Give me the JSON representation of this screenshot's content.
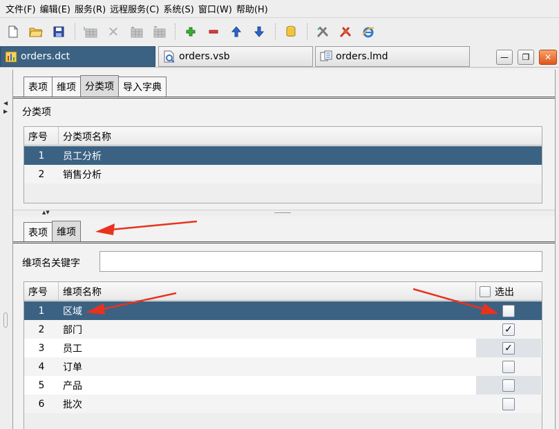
{
  "menu": [
    "文件(F)",
    "编辑(E)",
    "服务(R)",
    "远程服务(C)",
    "系统(S)",
    "窗口(W)",
    "帮助(H)"
  ],
  "toolbar": {
    "icons": [
      "new-file-icon",
      "open-folder-icon",
      "save-icon",
      "table-icon",
      "delete-icon",
      "table-up-icon",
      "table-down-icon",
      "add-icon",
      "remove-icon",
      "move-up-icon",
      "move-down-icon",
      "database-icon",
      "tools-icon",
      "bug-icon",
      "ie-icon"
    ]
  },
  "doc_tabs": [
    {
      "label": "orders.dct",
      "active": true
    },
    {
      "label": "orders.vsb",
      "active": false
    },
    {
      "label": "orders.lmd",
      "active": false
    }
  ],
  "top_tabs": [
    {
      "label": "表项",
      "active": false
    },
    {
      "label": "维项",
      "active": false
    },
    {
      "label": "分类项",
      "active": true
    },
    {
      "label": "导入字典",
      "active": false
    }
  ],
  "category_section": {
    "title": "分类项",
    "columns": [
      "序号",
      "分类项名称"
    ],
    "rows": [
      {
        "no": "1",
        "name": "员工分析",
        "selected": true
      },
      {
        "no": "2",
        "name": "销售分析",
        "selected": false
      }
    ]
  },
  "bottom_tabs": [
    {
      "label": "表项",
      "active": false
    },
    {
      "label": "维项",
      "active": true
    }
  ],
  "dimension_section": {
    "keyword_label": "维项名关键字",
    "keyword_value": "",
    "columns": [
      "序号",
      "维项名称",
      "选出"
    ],
    "rows": [
      {
        "no": "1",
        "name": "区域",
        "checked": false,
        "selected": true
      },
      {
        "no": "2",
        "name": "部门",
        "checked": true,
        "selected": false
      },
      {
        "no": "3",
        "name": "员工",
        "checked": true,
        "selected": false
      },
      {
        "no": "4",
        "name": "订单",
        "checked": false,
        "selected": false
      },
      {
        "no": "5",
        "name": "产品",
        "checked": false,
        "selected": false
      },
      {
        "no": "6",
        "name": "批次",
        "checked": false,
        "selected": false
      }
    ]
  },
  "colors": {
    "selection": "#3b6283",
    "annotation_arrow": "#e8321e"
  }
}
